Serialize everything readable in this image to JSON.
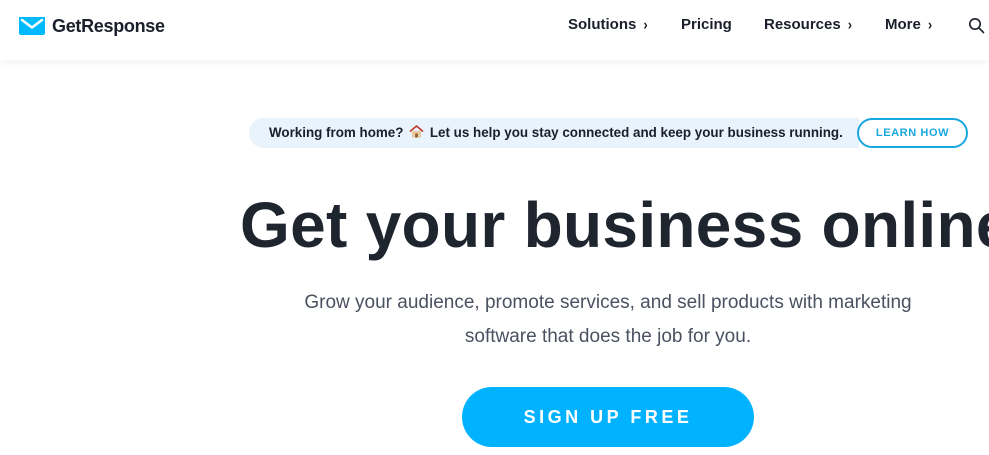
{
  "header": {
    "brand": "GetResponse",
    "nav": [
      {
        "label": "Solutions",
        "has_chevron": true
      },
      {
        "label": "Pricing",
        "has_chevron": false
      },
      {
        "label": "Resources",
        "has_chevron": true
      },
      {
        "label": "More",
        "has_chevron": true
      }
    ],
    "chevron": "›",
    "icons": {
      "logo": "envelope-logo-icon",
      "search": "search-icon",
      "chevron": "chevron-right-icon"
    }
  },
  "banner": {
    "text_before": "Working from home?",
    "text_after": "Let us help you stay connected and keep your business running.",
    "icon": "house-icon",
    "button_label": "LEARN HOW"
  },
  "hero": {
    "title": "Get your business online",
    "subtitle": "Grow your audience, promote services, and sell products with marketing software that does the job for you.",
    "cta_label": "SIGN UP FREE"
  },
  "colors": {
    "brand": "#00baff",
    "cta": "#00b2ff",
    "banner_bg": "#e9f3fb",
    "learn_border": "#1aa7e0",
    "text_dark": "#1f252f",
    "text_muted": "#4a5160"
  }
}
